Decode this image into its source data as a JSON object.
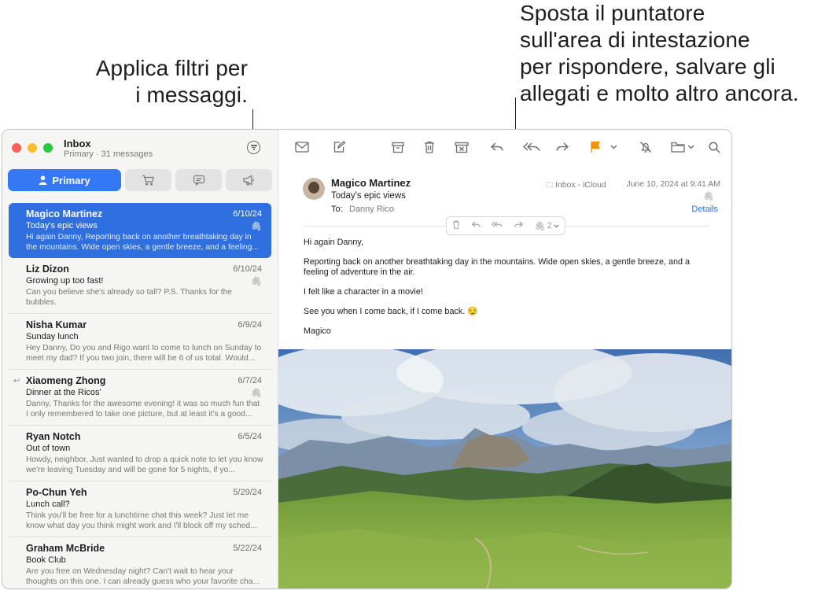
{
  "callouts": {
    "left": [
      "Applica filtri per",
      "i messaggi."
    ],
    "right": [
      "Sposta il puntatore",
      "sull'area di intestazione",
      "per rispondere, salvare gli",
      "allegati e molto altro ancora."
    ]
  },
  "colors": {
    "accent": "#3478f6",
    "selected_row": "#2f6fe0",
    "flag": "#f0920c",
    "close": "#fe5f57",
    "minimize": "#febc2e",
    "zoom": "#28c840"
  },
  "sidebar": {
    "title": "Inbox",
    "subtitle": "Primary · 31 messages",
    "filter_icon": "filter-icon",
    "categories": [
      {
        "label": "Primary",
        "icon": "person-icon"
      },
      {
        "label": "",
        "icon": "cart-icon"
      },
      {
        "label": "",
        "icon": "chat-bubble-icon"
      },
      {
        "label": "",
        "icon": "megaphone-icon"
      }
    ],
    "messages": [
      {
        "from": "Magico Martinez",
        "date": "6/10/24",
        "subject": "Today's epic views",
        "preview": "Hi again Danny, Reporting back on another breathtaking day in the mountains. Wide open skies, a gentle breeze, and a feeling...",
        "attachment": true,
        "selected": true
      },
      {
        "from": "Liz Dizon",
        "date": "6/10/24",
        "subject": "Growing up too fast!",
        "preview": "Can you believe she's already so tall? P.S. Thanks for the bubbles.",
        "attachment": true
      },
      {
        "from": "Nisha Kumar",
        "date": "6/9/24",
        "subject": "Sunday lunch",
        "preview": "Hey Danny, Do you and Rigo want to come to lunch on Sunday to meet my dad? If you two join, there will be 6 of us total. Would...",
        "attachment": false
      },
      {
        "from": "Xiaomeng Zhong",
        "date": "6/7/24",
        "subject": "Dinner at the Ricos'",
        "preview": "Danny, Thanks for the awesome evening! it was so much fun that I only remembered to take one picture, but at least it's a good...",
        "attachment": true,
        "replied": true
      },
      {
        "from": "Ryan Notch",
        "date": "6/5/24",
        "subject": "Out of town",
        "preview": "Howdy, neighbor, Just wanted to drop a quick note to let you know we're leaving Tuesday and will be gone for 5 nights, if yo...",
        "attachment": false
      },
      {
        "from": "Po-Chun Yeh",
        "date": "5/29/24",
        "subject": "Lunch call?",
        "preview": "Think you'll be free for a lunchtime chat this week? Just let me know what day you think might work and I'll block off my sched...",
        "attachment": false
      },
      {
        "from": "Graham McBride",
        "date": "5/22/24",
        "subject": "Book Club",
        "preview": "Are you free on Wednesday night? Can't wait to hear your thoughts on this one. I can already guess who your favorite cha...",
        "attachment": false
      }
    ]
  },
  "toolbar": {
    "icons": [
      "envelope-icon",
      "compose-icon",
      "archive-icon",
      "trash-icon",
      "junk-icon",
      "reply-icon",
      "reply-all-icon",
      "forward-icon",
      "flag-icon",
      "chevron-down-icon",
      "mute-bell-icon",
      "folder-icon",
      "chevron-down-icon",
      "search-icon"
    ]
  },
  "message": {
    "from": "Magico Martinez",
    "subject": "Today's epic views",
    "to_label": "To:",
    "to": "Danny Rico",
    "mailbox": "Inbox - iCloud",
    "date": "June 10, 2024 at 9:41 AM",
    "details_link": "Details",
    "hover_toolbar": {
      "attachment_count": "2"
    },
    "body": [
      "Hi again Danny,",
      "Reporting back on another breathtaking day in the mountains. Wide open skies, a gentle breeze, and a feeling of adventure in the air.",
      "I felt like a character in a movie!",
      "See you when I come back, if I come back. 😏",
      "Magico"
    ]
  }
}
